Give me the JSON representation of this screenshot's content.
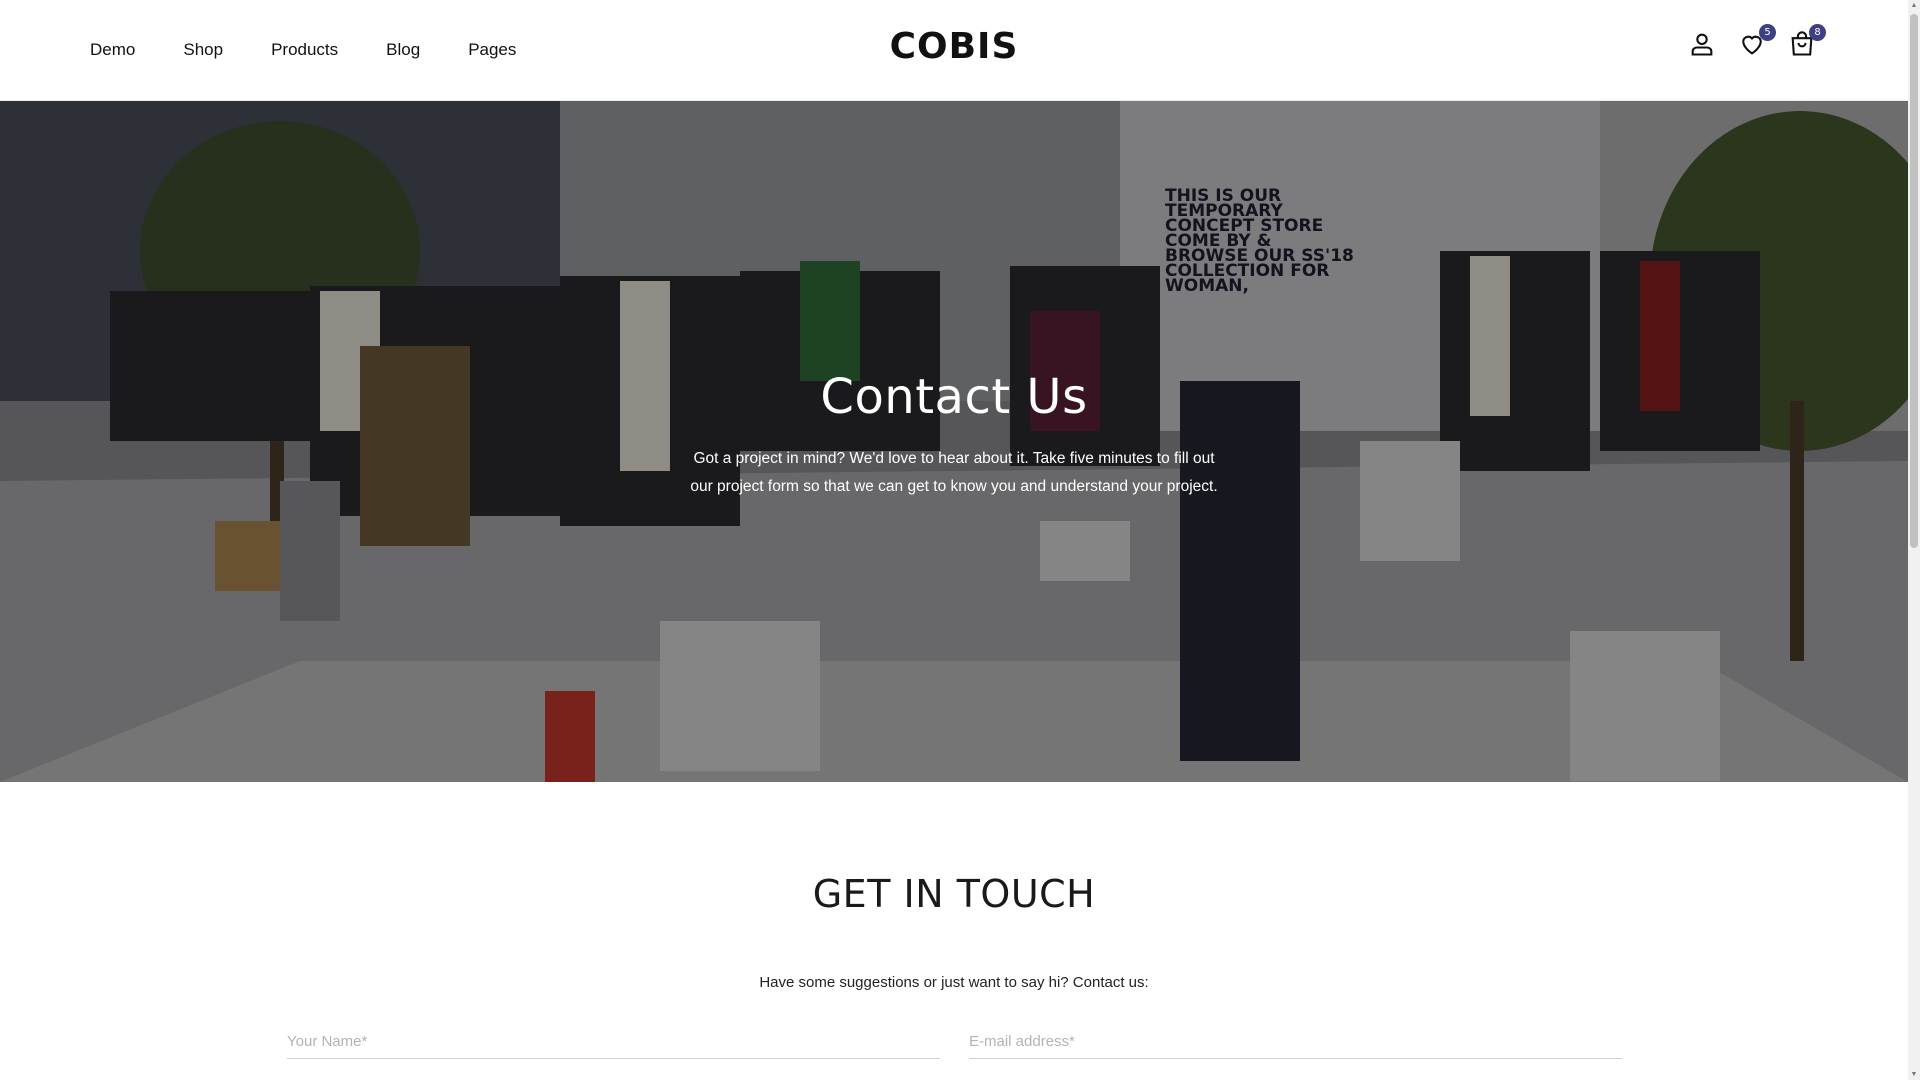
{
  "header": {
    "nav": [
      "Demo",
      "Shop",
      "Products",
      "Blog",
      "Pages"
    ],
    "logo": "COBIS",
    "wishlist_count": "5",
    "cart_count": "8",
    "icons": [
      "user-icon",
      "heart-icon",
      "shopping-bag-icon"
    ]
  },
  "hero": {
    "title": "Contact Us",
    "subtitle": "Got a project in mind? We'd love to hear about it. Take five minutes to fill out our project form so that we can get to know you and understand your project.",
    "store_sign": "THIS IS OUR TEMPORARY CONCEPT STORE COME BY & BROWSE OUR SS'18 COLLECTION FOR WOMAN,"
  },
  "contact": {
    "title": "GET IN TOUCH",
    "subtitle": "Have some suggestions or just want to say hi? Contact us:",
    "name_placeholder": "Your Name*",
    "email_placeholder": "E-mail address*"
  },
  "colors": {
    "badge": "#3f3f86",
    "text": "#111111"
  }
}
